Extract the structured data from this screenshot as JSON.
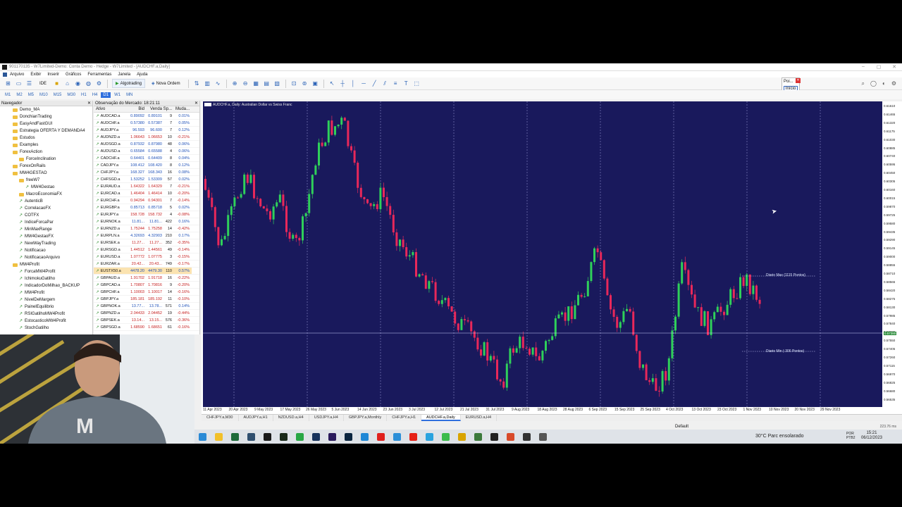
{
  "window": {
    "title": "901170135 - W7Limited-Demo: Conta Demo - Hedge - W7Limited - [AUDCHF.a,Daily]"
  },
  "menu": [
    "Arquivo",
    "Exibir",
    "Inserir",
    "Gráficos",
    "Ferramentas",
    "Janela",
    "Ajuda"
  ],
  "toolbar": {
    "ide": "IDE",
    "algotrading": "Algotrading",
    "nova_ordem": "Nova Ordem"
  },
  "timeframes": [
    "M1",
    "M2",
    "M5",
    "M10",
    "M15",
    "M30",
    "H1",
    "H4",
    "D1",
    "W1",
    "MN"
  ],
  "active_timeframe": "D1",
  "popup": {
    "title": "Poi...",
    "button": "Início"
  },
  "navigator": {
    "title": "Navegador",
    "items": [
      "Demo_MA",
      "DonchianTrading",
      "EasyAndFastGUI",
      "Estrategia OFERTA Y DEMANDA4",
      "Estudos",
      "Examples",
      "ForexAction",
      "ForceInclination",
      "ForexOnRails",
      "MW4GESTAO",
      "freeW7",
      "MW4Gestao",
      "MacroEconomiaFX",
      "AutenticB",
      "CorrelacaoFX",
      "COTFX",
      "IndiceForcaPar",
      "MinMaxRange",
      "MW4GestaoFX",
      "NewWayTrading",
      "Notificacao",
      "NotificacaoArquivo",
      "MW4Profit",
      "ForcaMW4Profit",
      "IchimokuGatilho",
      "IndicadorDoMilhao_BACKUP",
      "MW4Profit",
      "NivelDeMargem",
      "PainelEquilibrio",
      "RSIGatilhoMW4Profit",
      "EstocasticoMW4Profit",
      "StochGatilho"
    ]
  },
  "market_watch": {
    "title": "Observação do Mercado: 18:21:11",
    "columns": [
      "Ativo",
      "Bid",
      "Venda",
      "Sp...",
      "Muda..."
    ],
    "rows": [
      [
        "AUDCAD.a",
        "0.89092",
        "0.89101",
        "9",
        "0.01%"
      ],
      [
        "AUDCHF.a",
        "0.57380",
        "0.57387",
        "7",
        "0.05%"
      ],
      [
        "AUDJPY.a",
        "96.593",
        "96.600",
        "7",
        "0.12%"
      ],
      [
        "AUDNZD.a",
        "1.06643",
        "1.06653",
        "10",
        "-0.21%"
      ],
      [
        "AUDSGD.a",
        "0.87932",
        "0.87980",
        "48",
        "0.06%"
      ],
      [
        "AUDUSD.a",
        "0.65584",
        "0.65588",
        "4",
        "0.06%"
      ],
      [
        "CADCHF.a",
        "0.64401",
        "0.64409",
        "8",
        "0.04%"
      ],
      [
        "CADJPY.a",
        "108.412",
        "108.420",
        "8",
        "0.12%"
      ],
      [
        "CHFJPY.a",
        "168.327",
        "168.343",
        "16",
        "0.08%"
      ],
      [
        "CHFSGD.a",
        "1.53252",
        "1.53309",
        "57",
        "0.02%"
      ],
      [
        "EURAUD.a",
        "1.64322",
        "1.64329",
        "7",
        "-0.21%"
      ],
      [
        "EURCAD.a",
        "1.46404",
        "1.46414",
        "10",
        "-0.20%"
      ],
      [
        "EURCHF.a",
        "0.94294",
        "0.94301",
        "7",
        "-0.14%"
      ],
      [
        "EURGBP.a",
        "0.85713",
        "0.85718",
        "5",
        "0.02%"
      ],
      [
        "EURJPY.a",
        "158.728",
        "158.732",
        "4",
        "-0.08%"
      ],
      [
        "EURNOK.a",
        "11.81...",
        "11.81...",
        "422",
        "0.16%"
      ],
      [
        "EURNZD.a",
        "1.75244",
        "1.75258",
        "14",
        "-0.42%"
      ],
      [
        "EURPLN.a",
        "4.32693",
        "4.32903",
        "210",
        "0.17%"
      ],
      [
        "EURSEK.a",
        "11.27...",
        "11.27...",
        "352",
        "-0.35%"
      ],
      [
        "EURSGD.a",
        "1.44512",
        "1.44561",
        "49",
        "-0.14%"
      ],
      [
        "EURUSD.a",
        "1.07772",
        "1.07775",
        "3",
        "-0.15%"
      ],
      [
        "EURZAR.a",
        "20.42...",
        "20.43...",
        "749",
        "-0.17%"
      ],
      [
        "EUSTX50.a",
        "4478.20",
        "4479.30",
        "110",
        "0.57%"
      ],
      [
        "GBPAUD.a",
        "1.91702",
        "1.91718",
        "16",
        "-0.22%"
      ],
      [
        "GBPCAD.a",
        "1.70807",
        "1.70816",
        "9",
        "-0.20%"
      ],
      [
        "GBPCHF.a",
        "1.10003",
        "1.10017",
        "14",
        "-0.16%"
      ],
      [
        "GBPJPY.a",
        "185.181",
        "185.192",
        "11",
        "-0.10%"
      ],
      [
        "GBPNOK.a",
        "13.77...",
        "13.78...",
        "571",
        "0.14%"
      ],
      [
        "GBPNZD.a",
        "2.04433",
        "2.04452",
        "19",
        "-0.44%"
      ],
      [
        "GBPSEK.a",
        "13.14...",
        "13.15...",
        "576",
        "-0.36%"
      ],
      [
        "GBPSGD.a",
        "1.68590",
        "1.68651",
        "61",
        "-0.16%"
      ]
    ]
  },
  "chart": {
    "symbol": "AUDCHF.a, Daily: Australian Dollar vs Swiss Franc",
    "level_max": "Diario Max (1115 Pontos)",
    "level_min": "Diario Min (-306 Pontos)",
    "current_price": "0.57380",
    "price_ticks": [
      "0.61610",
      "0.61465",
      "0.61320",
      "0.61175",
      "0.61030",
      "0.60885",
      "0.60740",
      "0.60595",
      "0.60450",
      "0.60305",
      "0.60160",
      "0.60015",
      "0.59870",
      "0.59725",
      "0.59580",
      "0.59435",
      "0.59290",
      "0.59145",
      "0.59000",
      "0.58855",
      "0.58710",
      "0.58565",
      "0.58420",
      "0.58275",
      "0.58130",
      "0.57985",
      "0.57840",
      "0.57695",
      "0.57550",
      "0.57405",
      "0.57260",
      "0.57115",
      "0.56970",
      "0.56825",
      "0.56680",
      "0.56535"
    ],
    "time_ticks": [
      "11 Apr 2023",
      "20 Apr 2023",
      "9 May 2023",
      "17 May 2023",
      "26 May 2023",
      "5 Jun 2023",
      "14 Jun 2023",
      "23 Jun 2023",
      "3 Jul 2023",
      "12 Jul 2023",
      "21 Jul 2023",
      "31 Jul 2023",
      "9 Aug 2023",
      "18 Aug 2023",
      "28 Aug 2023",
      "6 Sep 2023",
      "15 Sep 2023",
      "25 Sep 2023",
      "4 Oct 2023",
      "13 Oct 2023",
      "23 Oct 2023",
      "1 Nov 2023",
      "10 Nov 2023",
      "20 Nov 2023",
      "29 Nov 2023"
    ]
  },
  "chart_tabs": [
    "CHFJPY.a,M30",
    "AUDJPY.a,H1",
    "NZDUSD.a,H4",
    "USDJPY.a,H4",
    "GBPJPY.a,Monthly",
    "CHFJPY.a,H1",
    "AUDCHF.a,Daily",
    "EURUSD.a,H4"
  ],
  "active_chart_tab": "AUDCHF.a,Daily",
  "status": {
    "profile": "Default",
    "ping": "223.76 ms"
  },
  "taskbar": {
    "weather": "30°C  Parc ensolarado",
    "lang": "POR\nPTB2",
    "time": "15:21",
    "date": "06/12/2023"
  },
  "colors": {
    "chart_bg": "#19195c",
    "bull": "#2fd05a",
    "bear": "#e8285a",
    "accent": "#2f6fde"
  }
}
